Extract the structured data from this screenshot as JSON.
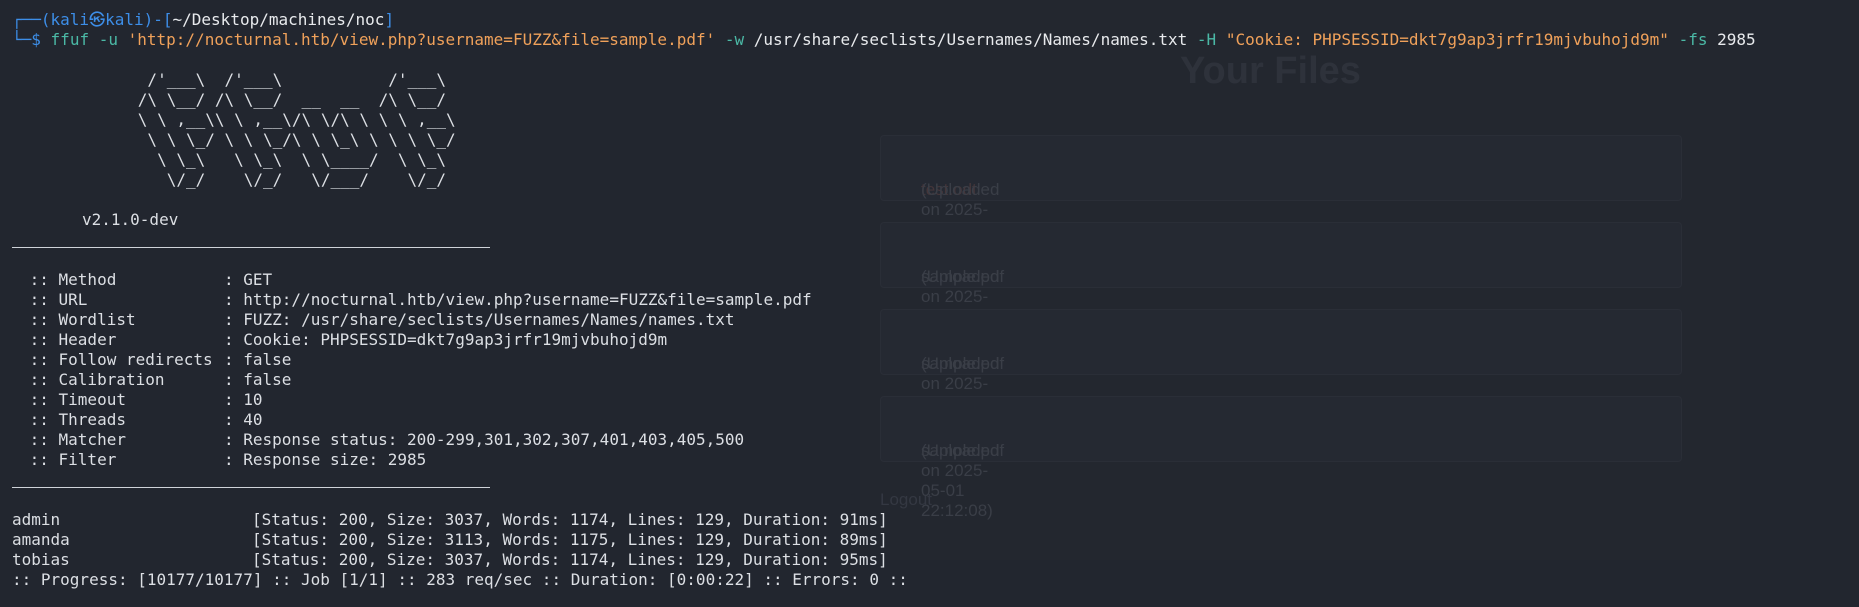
{
  "prompt": {
    "corner": "┌──(",
    "user": "kali㉿kali",
    "mid": ")-[",
    "path": "~/Desktop/machines/noc",
    "end": "]",
    "corner2": "└─",
    "dollar": "$",
    "cmd": "ffuf",
    "flag_u": "-u",
    "url_arg": "'http://nocturnal.htb/view.php?username=FUZZ&file=sample.pdf'",
    "flag_w": "-w",
    "wordlist_arg": "/usr/share/seclists/Usernames/Names/names.txt",
    "flag_h": "-H",
    "header_arg": "\"Cookie: PHPSESSID=dkt7g9ap3jrfr19mjvbuhojd9m\"",
    "flag_fs": "-fs",
    "fs_arg": "2985"
  },
  "banner": {
    "art": "       /'___\\  /'___\\           /'___\\\n      /\\ \\__/ /\\ \\__/  __  __  /\\ \\__/\n      \\ \\ ,__\\\\ \\ ,__\\/\\ \\/\\ \\ \\ \\ ,__\\\n       \\ \\ \\_/ \\ \\ \\_/\\ \\ \\_\\ \\ \\ \\ \\_/\n        \\ \\_\\   \\ \\_\\  \\ \\____/  \\ \\_\\\n         \\/_/    \\/_/   \\/___/    \\/_/",
    "version": "v2.1.0-dev"
  },
  "config": [
    {
      "key": " :: Method",
      "value": ": GET"
    },
    {
      "key": " :: URL",
      "value": ": http://nocturnal.htb/view.php?username=FUZZ&file=sample.pdf"
    },
    {
      "key": " :: Wordlist",
      "value": ": FUZZ: /usr/share/seclists/Usernames/Names/names.txt"
    },
    {
      "key": " :: Header",
      "value": ": Cookie: PHPSESSID=dkt7g9ap3jrfr19mjvbuhojd9m"
    },
    {
      "key": " :: Follow redirects",
      "value": ": false"
    },
    {
      "key": " :: Calibration",
      "value": ": false"
    },
    {
      "key": " :: Timeout",
      "value": ": 10"
    },
    {
      "key": " :: Threads",
      "value": ": 40"
    },
    {
      "key": " :: Matcher",
      "value": ": Response status: 200-299,301,302,307,401,403,405,500"
    },
    {
      "key": " :: Filter",
      "value": ": Response size: 2985"
    }
  ],
  "results": [
    {
      "word": "admin",
      "info": "[Status: 200, Size: 3037, Words: 1174, Lines: 129, Duration: 91ms]"
    },
    {
      "word": "amanda",
      "info": "[Status: 200, Size: 3113, Words: 1175, Lines: 129, Duration: 89ms]"
    },
    {
      "word": "tobias",
      "info": "[Status: 200, Size: 3037, Words: 1174, Lines: 129, Duration: 95ms]"
    }
  ],
  "progress": ":: Progress: [10177/10177] :: Job [1/1] :: 283 req/sec :: Duration: [0:00:22] :: Errors: 0 ::",
  "background_page": {
    "title": "Your Files",
    "files": [
      {
        "name": "test.odt",
        "meta": " (Uploaded on 2025-05-01 22:06:09)"
      },
      {
        "name": "sample.pdf",
        "meta": " (Uploaded on 2025-05-01 22:11:08)"
      },
      {
        "name": "sample.pdf",
        "meta": " (Uploaded on 2025-05-01 22:11:56)"
      },
      {
        "name": "sample.pdf",
        "meta": " (Uploaded on 2025-05-01 22:12:08)"
      }
    ],
    "logout": "Logout"
  }
}
